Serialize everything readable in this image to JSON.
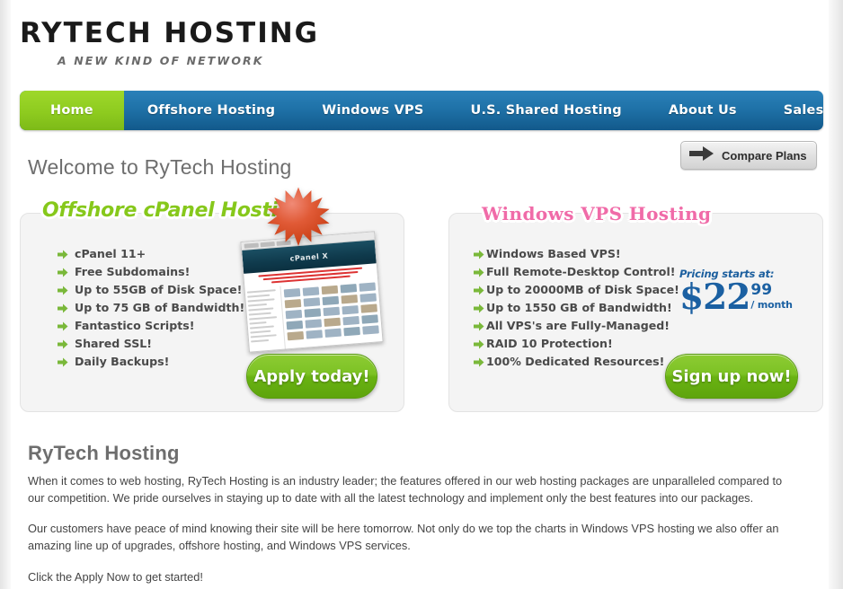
{
  "brand": {
    "logo_main": "RYTECH HOSTING",
    "logo_sub": "A NEW KIND OF NETWORK"
  },
  "nav": {
    "items": [
      {
        "label": "Home",
        "active": true
      },
      {
        "label": "Offshore Hosting",
        "active": false
      },
      {
        "label": "Windows VPS",
        "active": false
      },
      {
        "label": "U.S. Shared Hosting",
        "active": false
      },
      {
        "label": "About Us",
        "active": false
      },
      {
        "label": "Sales/Support",
        "active": false
      }
    ],
    "active_color": "#8ecb1f",
    "bar_color": "#1f72a8"
  },
  "welcome": {
    "heading": "Welcome to RyTech Hosting",
    "compare_button": "Compare Plans",
    "compare_icon": "arrow-right-icon"
  },
  "promos": {
    "left": {
      "title": "Offshore cPanel Hosting",
      "title_color": "#86c81b",
      "badge_icon": "starburst-badge",
      "badge_color": "#e0502a",
      "thumbnail_icon": "cpanel-screenshot",
      "thumbnail_banner": "cPanel X",
      "bullet_icon": "green-arrow-bullet",
      "features": [
        "cPanel 11+",
        "Free Subdomains!",
        "Up to 55GB of Disk Space!",
        "Up to 75 GB of Bandwidth!",
        "Fantastico Scripts!",
        "Shared SSL!",
        "Daily Backups!"
      ],
      "cta": "Apply today!"
    },
    "right": {
      "title": "Windows VPS  Hosting",
      "title_color": "#f06ba8",
      "bullet_icon": "green-arrow-bullet",
      "features": [
        "Windows Based VPS!",
        "Full Remote-Desktop Control!",
        "Up to 20000MB of Disk Space!",
        "Up to 1550 GB of Bandwidth!",
        "All VPS's are Fully-Managed!",
        "RAID 10 Protection!",
        "100% Dedicated Resources!"
      ],
      "pricing": {
        "label": "Pricing starts at:",
        "amount": "$22",
        "cents": "99",
        "period": "/ month",
        "color": "#1b60a2"
      },
      "cta": "Sign up now!"
    }
  },
  "content": {
    "title": "RyTech Hosting",
    "paragraph_1": "When it comes to web hosting, RyTech Hosting is an industry leader; the features offered in our web hosting packages are unparalleled compared to our competition. We pride ourselves in staying up to date with all the latest technology and implement only the best features into our packages.",
    "paragraph_2": "Our customers have peace of mind knowing their site will be here tomorrow. Not only do we top the charts in Windows VPS hosting we also offer an amazing line up of upgrades, offshore hosting, and Windows VPS services.",
    "paragraph_3": "Click the Apply Now to get started!"
  }
}
